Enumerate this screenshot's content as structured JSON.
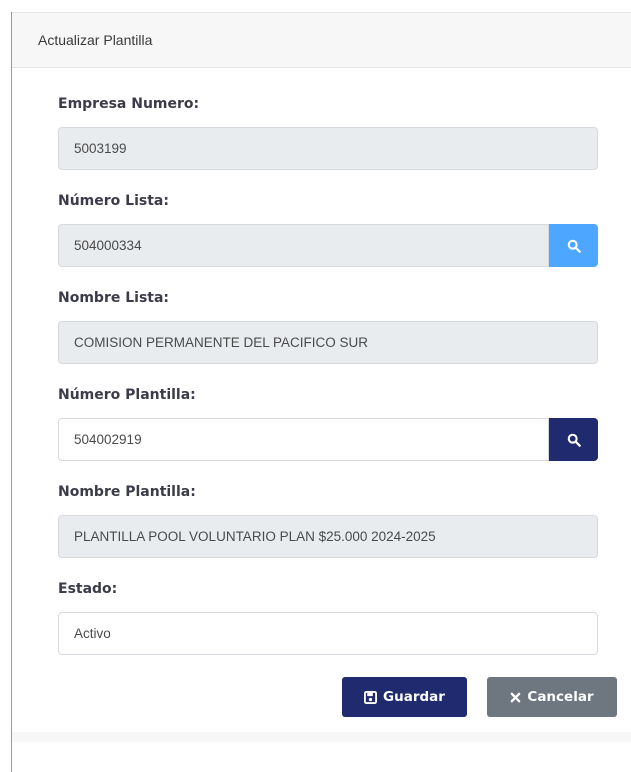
{
  "modal": {
    "title": "Actualizar Plantilla"
  },
  "form": {
    "empresa_numero": {
      "label": "Empresa Numero:",
      "value": "5003199"
    },
    "numero_lista": {
      "label": "Número Lista:",
      "value": "504000334"
    },
    "nombre_lista": {
      "label": "Nombre Lista:",
      "value": "COMISION PERMANENTE DEL PACIFICO SUR"
    },
    "numero_plantilla": {
      "label": "Número Plantilla:",
      "value": "504002919"
    },
    "nombre_plantilla": {
      "label": "Nombre Plantilla:",
      "value": "PLANTILLA POOL VOLUNTARIO PLAN $25.000 2024-2025"
    },
    "estado": {
      "label": "Estado:",
      "value": "Activo"
    }
  },
  "buttons": {
    "save_label": "Guardar",
    "cancel_label": "Cancelar"
  },
  "colors": {
    "primary": "#1f2b6e",
    "info": "#4da6ff",
    "secondary": "#6e7780",
    "readonly_bg": "#e9ecef"
  },
  "icons": {
    "search": "search-icon",
    "save": "floppy-disk-icon",
    "cancel": "close-icon"
  }
}
